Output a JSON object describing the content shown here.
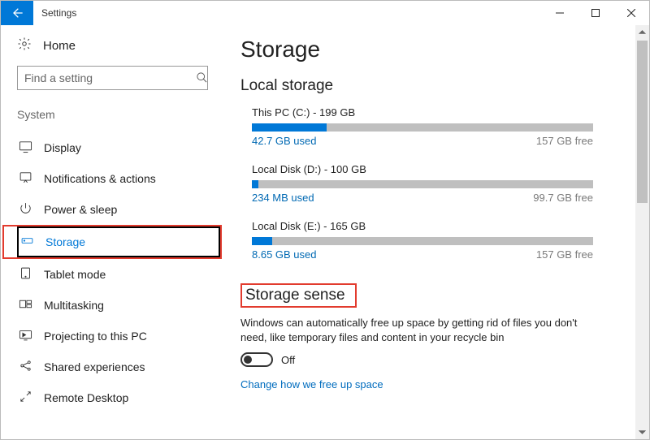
{
  "window": {
    "title": "Settings"
  },
  "sidebar": {
    "home": "Home",
    "search_placeholder": "Find a setting",
    "section": "System",
    "items": [
      {
        "label": "Display"
      },
      {
        "label": "Notifications & actions"
      },
      {
        "label": "Power & sleep"
      },
      {
        "label": "Storage",
        "active": true
      },
      {
        "label": "Tablet mode"
      },
      {
        "label": "Multitasking"
      },
      {
        "label": "Projecting to this PC"
      },
      {
        "label": "Shared experiences"
      },
      {
        "label": "Remote Desktop"
      }
    ]
  },
  "page": {
    "title": "Storage",
    "local_heading": "Local storage",
    "disks": [
      {
        "title": "This PC (C:) - 199 GB",
        "used": "42.7 GB used",
        "free": "157 GB free",
        "fill_pct": 22,
        "primary": true
      },
      {
        "title": "Local Disk (D:) - 100 GB",
        "used": "234 MB used",
        "free": "99.7 GB free",
        "fill_pct": 2,
        "primary": false
      },
      {
        "title": "Local Disk (E:) - 165 GB",
        "used": "8.65 GB used",
        "free": "157 GB free",
        "fill_pct": 6,
        "primary": false
      }
    ],
    "sense": {
      "heading": "Storage sense",
      "desc": "Windows can automatically free up space by getting rid of files you don't need, like temporary files and content in your recycle bin",
      "toggle_state": "Off",
      "link": "Change how we free up space"
    }
  }
}
